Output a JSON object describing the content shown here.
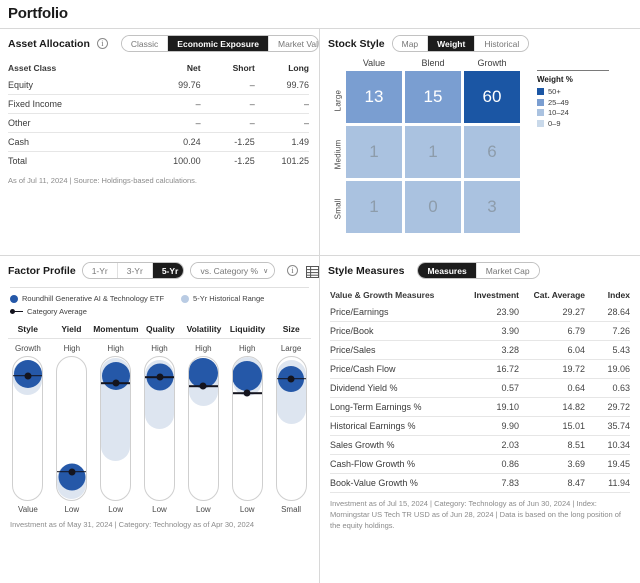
{
  "page": {
    "title": "Portfolio"
  },
  "colors": {
    "accent_blue": "#2558a8",
    "weight_50plus": "#1b56a4",
    "weight_25_49": "#7a9ed1",
    "weight_10_24": "#aac2e0",
    "weight_0_9": "#c9d9ea",
    "range_fill": "#dde5f0",
    "marker_dark": "#14141e"
  },
  "asset_allocation": {
    "title": "Asset Allocation",
    "info_icon": "info-icon",
    "tabs": [
      {
        "label": "Classic",
        "selected": false
      },
      {
        "label": "Economic Exposure",
        "selected": true
      },
      {
        "label": "Market Value",
        "selected": false
      }
    ],
    "columns": [
      "Asset Class",
      "Net",
      "Short",
      "Long"
    ],
    "rows": [
      {
        "name": "Equity",
        "net": "99.76",
        "short": "–",
        "long": "99.76"
      },
      {
        "name": "Fixed Income",
        "net": "–",
        "short": "–",
        "long": "–"
      },
      {
        "name": "Other",
        "net": "–",
        "short": "–",
        "long": "–"
      },
      {
        "name": "Cash",
        "net": "0.24",
        "short": "-1.25",
        "long": "1.49"
      }
    ],
    "total": {
      "name": "Total",
      "net": "100.00",
      "short": "-1.25",
      "long": "101.25"
    },
    "footnote": "As of Jul 11, 2024 | Source: Holdings-based calculations."
  },
  "stock_style": {
    "title": "Stock Style",
    "tabs": [
      {
        "label": "Map",
        "selected": false
      },
      {
        "label": "Weight",
        "selected": true
      },
      {
        "label": "Historical",
        "selected": false
      }
    ],
    "col_labels": [
      "Value",
      "Blend",
      "Growth"
    ],
    "row_labels": [
      "Large",
      "Medium",
      "Small"
    ],
    "cells": [
      [
        {
          "value": "13",
          "band": "25_49"
        },
        {
          "value": "15",
          "band": "25_49"
        },
        {
          "value": "60",
          "band": "50plus"
        }
      ],
      [
        {
          "value": "1",
          "band": "10_24"
        },
        {
          "value": "1",
          "band": "10_24"
        },
        {
          "value": "6",
          "band": "10_24"
        }
      ],
      [
        {
          "value": "1",
          "band": "10_24"
        },
        {
          "value": "0",
          "band": "10_24"
        },
        {
          "value": "3",
          "band": "10_24"
        }
      ]
    ],
    "legend": {
      "title": "Weight %",
      "items": [
        {
          "label": "50+",
          "band": "50plus"
        },
        {
          "label": "25–49",
          "band": "25_49"
        },
        {
          "label": "10–24",
          "band": "10_24"
        },
        {
          "label": "0–9",
          "band": "0_9"
        }
      ]
    }
  },
  "factor_profile": {
    "title": "Factor Profile",
    "period_tabs": [
      {
        "label": "1-Yr",
        "selected": false
      },
      {
        "label": "3-Yr",
        "selected": false
      },
      {
        "label": "5-Yr",
        "selected": true
      }
    ],
    "compare_select": {
      "label": "vs. Category %",
      "caret": "∨"
    },
    "info_icon": "info-icon",
    "table_icon": "table-icon",
    "legend": [
      {
        "label": "Roundhill Generative AI & Technology ETF",
        "marker": "dot-blue"
      },
      {
        "label": "5-Yr Historical Range",
        "marker": "dot-lightblue"
      },
      {
        "label": "Category Average",
        "marker": "line-dot-dark"
      }
    ],
    "factors": [
      {
        "name": "Style",
        "top_label": "Growth",
        "bottom_label": "Value",
        "ball_pct": 12,
        "ball_size": 28,
        "range_top_pct": 2,
        "range_bottom_pct": 26,
        "avg_pct": 13
      },
      {
        "name": "Yield",
        "top_label": "High",
        "bottom_label": "Low",
        "ball_pct": 83,
        "ball_size": 27,
        "range_top_pct": 74,
        "range_bottom_pct": 98,
        "avg_pct": 79
      },
      {
        "name": "Momentum",
        "top_label": "High",
        "bottom_label": "Low",
        "ball_pct": 13,
        "ball_size": 28,
        "range_top_pct": 1,
        "range_bottom_pct": 72,
        "avg_pct": 18
      },
      {
        "name": "Quality",
        "top_label": "High",
        "bottom_label": "Low",
        "ball_pct": 14,
        "ball_size": 27,
        "range_top_pct": 2,
        "range_bottom_pct": 50,
        "avg_pct": 14
      },
      {
        "name": "Volatility",
        "top_label": "High",
        "bottom_label": "Low",
        "ball_pct": 11,
        "ball_size": 30,
        "range_top_pct": 1,
        "range_bottom_pct": 34,
        "avg_pct": 20
      },
      {
        "name": "Liquidity",
        "top_label": "High",
        "bottom_label": "Low",
        "ball_pct": 13,
        "ball_size": 30,
        "range_top_pct": 0,
        "range_bottom_pct": 27,
        "avg_pct": 25
      },
      {
        "name": "Size",
        "top_label": "Large",
        "bottom_label": "Small",
        "ball_pct": 15,
        "ball_size": 26,
        "range_top_pct": 2,
        "range_bottom_pct": 46,
        "avg_pct": 15
      }
    ],
    "footnote": "Investment as of May 31, 2024 | Category: Technology as of Apr 30, 2024"
  },
  "style_measures": {
    "title": "Style Measures",
    "tabs": [
      {
        "label": "Measures",
        "selected": true
      },
      {
        "label": "Market Cap",
        "selected": false
      }
    ],
    "columns": [
      "Value & Growth Measures",
      "Investment",
      "Cat. Average",
      "Index"
    ],
    "rows": [
      {
        "name": "Price/Earnings",
        "investment": "23.90",
        "cat_average": "29.27",
        "index": "28.64"
      },
      {
        "name": "Price/Book",
        "investment": "3.90",
        "cat_average": "6.79",
        "index": "7.26"
      },
      {
        "name": "Price/Sales",
        "investment": "3.28",
        "cat_average": "6.04",
        "index": "5.43"
      },
      {
        "name": "Price/Cash Flow",
        "investment": "16.72",
        "cat_average": "19.72",
        "index": "19.06"
      },
      {
        "name": "Dividend Yield %",
        "investment": "0.57",
        "cat_average": "0.64",
        "index": "0.63"
      },
      {
        "name": "Long-Term Earnings %",
        "investment": "19.10",
        "cat_average": "14.82",
        "index": "29.72"
      },
      {
        "name": "Historical Earnings %",
        "investment": "9.90",
        "cat_average": "15.01",
        "index": "35.74"
      },
      {
        "name": "Sales Growth %",
        "investment": "2.03",
        "cat_average": "8.51",
        "index": "10.34"
      },
      {
        "name": "Cash-Flow Growth %",
        "investment": "0.86",
        "cat_average": "3.69",
        "index": "19.45"
      },
      {
        "name": "Book-Value Growth %",
        "investment": "7.83",
        "cat_average": "8.47",
        "index": "11.94"
      }
    ],
    "footnote": "Investment as of Jul 15, 2024 | Category: Technology as of Jun 30, 2024 | Index: Morningstar US Tech TR USD as of Jun 28, 2024 | Data is based on the long position of the equity holdings."
  }
}
